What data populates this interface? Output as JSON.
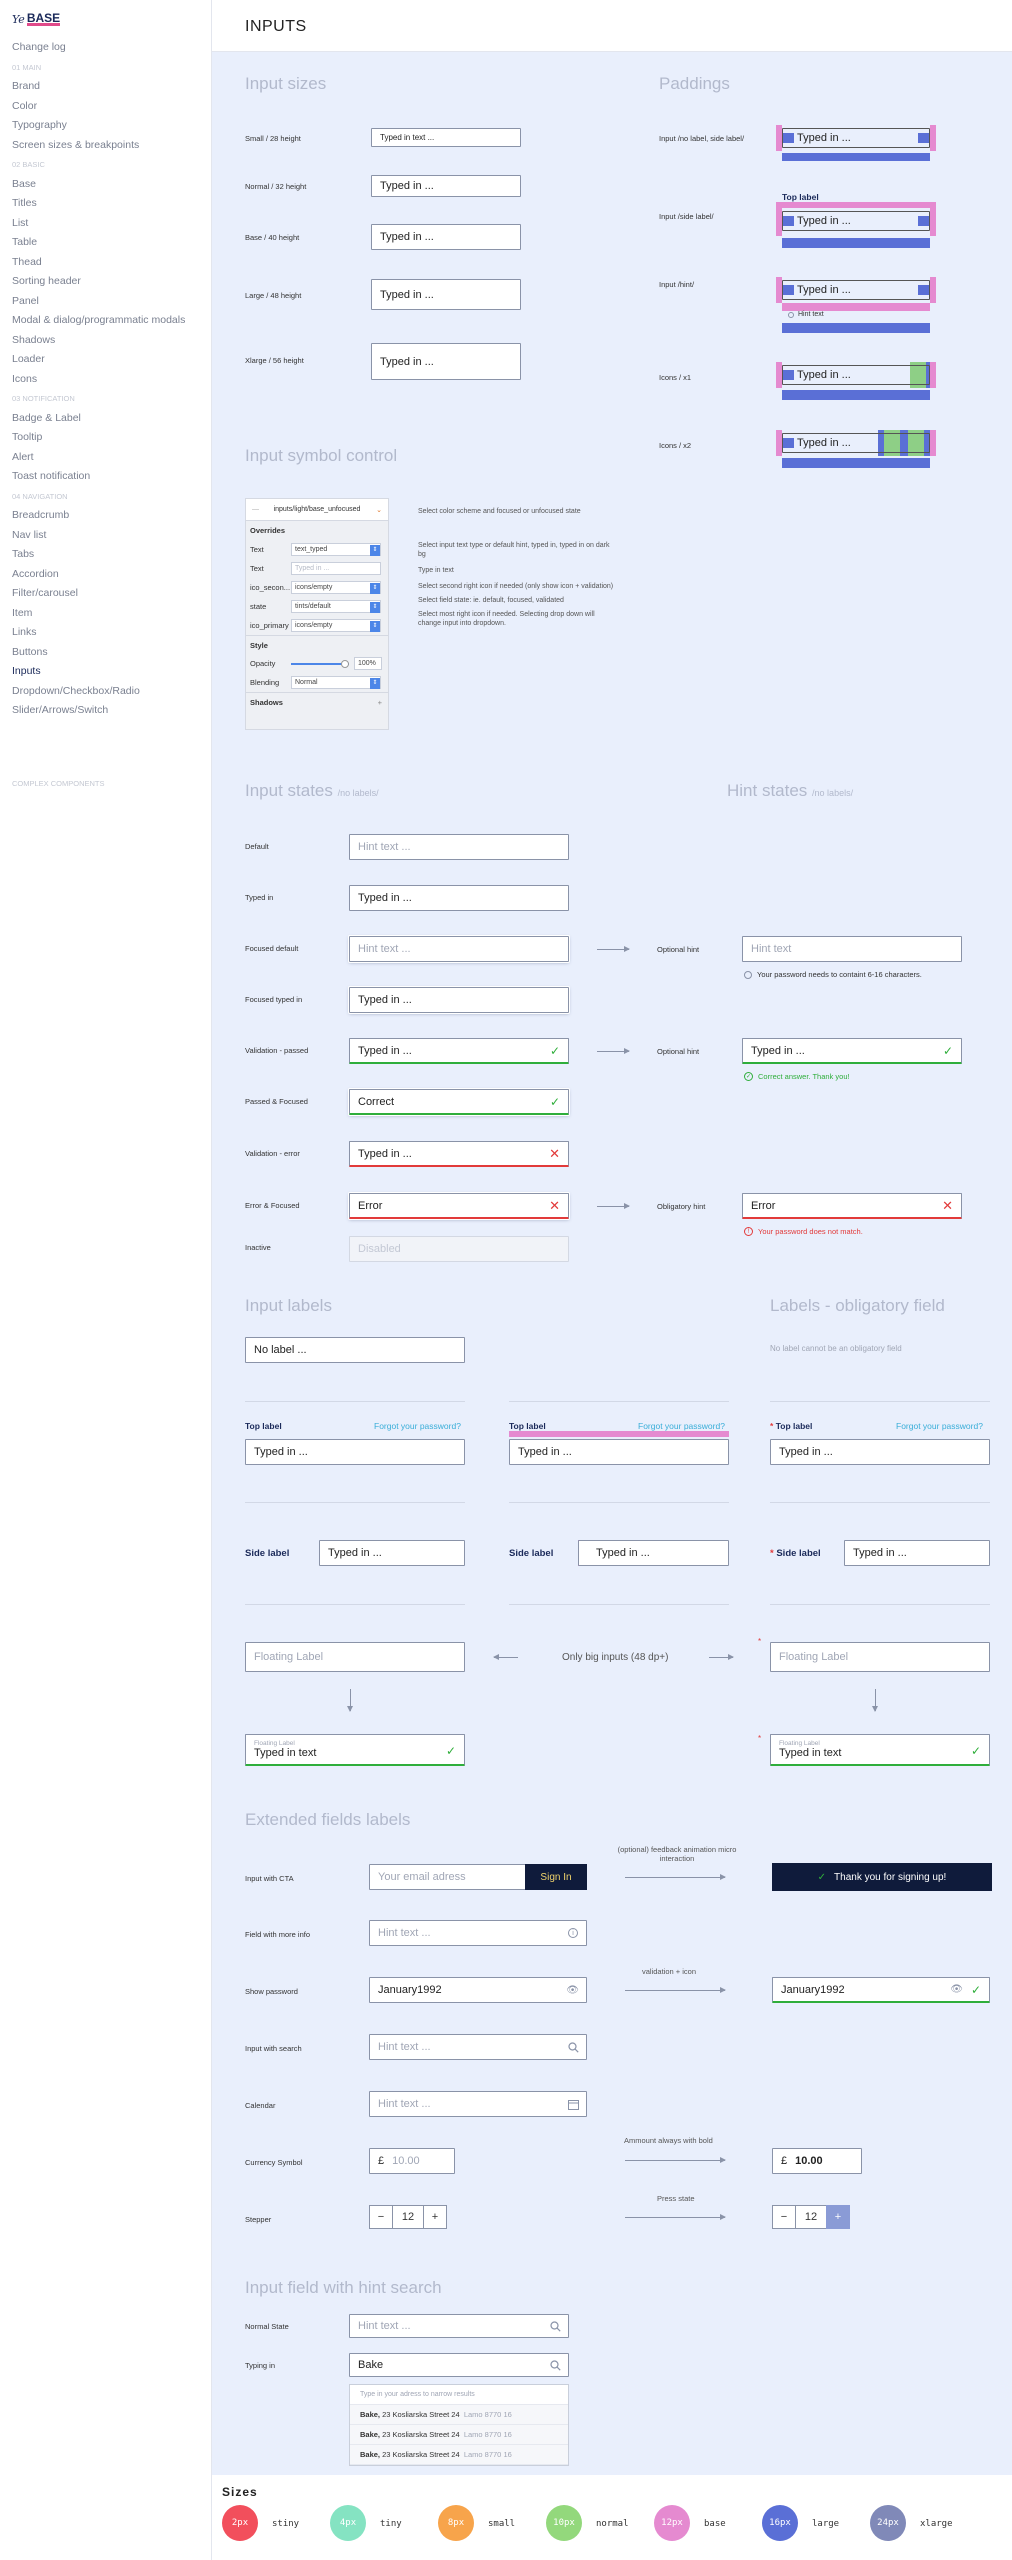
{
  "sidebar": {
    "logo_script": "Ye",
    "logo_base": "BASE",
    "items": [
      {
        "label": "Change log",
        "type": "item"
      },
      {
        "label": "01 MAIN",
        "type": "section"
      },
      {
        "label": "Brand",
        "type": "item"
      },
      {
        "label": "Color",
        "type": "item"
      },
      {
        "label": "Typography",
        "type": "item"
      },
      {
        "label": "Screen sizes & breakpoints",
        "type": "item"
      },
      {
        "label": "02 BASIC",
        "type": "section"
      },
      {
        "label": "Base",
        "type": "item"
      },
      {
        "label": "Titles",
        "type": "item"
      },
      {
        "label": "List",
        "type": "item"
      },
      {
        "label": "Table",
        "type": "item"
      },
      {
        "label": "Thead",
        "type": "item"
      },
      {
        "label": "Sorting header",
        "type": "item"
      },
      {
        "label": "Panel",
        "type": "item"
      },
      {
        "label": "Modal & dialog/programmatic modals",
        "type": "item"
      },
      {
        "label": "Shadows",
        "type": "item"
      },
      {
        "label": "Loader",
        "type": "item"
      },
      {
        "label": "Icons",
        "type": "item"
      },
      {
        "label": "03 NOTIFICATION",
        "type": "section"
      },
      {
        "label": "Badge & Label",
        "type": "item"
      },
      {
        "label": "Tooltip",
        "type": "item"
      },
      {
        "label": "Alert",
        "type": "item"
      },
      {
        "label": "Toast notification",
        "type": "item"
      },
      {
        "label": "04 NAVIGATION",
        "type": "section"
      },
      {
        "label": "Breadcrumb",
        "type": "item"
      },
      {
        "label": "Nav list",
        "type": "item"
      },
      {
        "label": "Tabs",
        "type": "item"
      },
      {
        "label": "Accordion",
        "type": "item"
      },
      {
        "label": "Filter/carousel",
        "type": "item"
      },
      {
        "label": "Item",
        "type": "item"
      },
      {
        "label": "Links",
        "type": "item"
      },
      {
        "label": "Buttons",
        "type": "item"
      },
      {
        "label": "Inputs",
        "type": "item",
        "active": true
      },
      {
        "label": "Dropdown/Checkbox/Radio",
        "type": "item"
      },
      {
        "label": "Slider/Arrows/Switch",
        "type": "item"
      }
    ],
    "footer": "COMPLEX COMPONENTS"
  },
  "header": {
    "title": "INPUTS"
  },
  "sizes_section": {
    "title": "Input sizes",
    "rows": [
      {
        "label": "Small / 28 height",
        "value": "Typed in text ..."
      },
      {
        "label": "Normal / 32 height",
        "value": "Typed in ..."
      },
      {
        "label": "Base / 40 height",
        "value": "Typed in ..."
      },
      {
        "label": "Large / 48 height",
        "value": "Typed in ..."
      },
      {
        "label": "Xlarge / 56 height",
        "value": "Typed in ..."
      }
    ]
  },
  "paddings_section": {
    "title": "Paddings",
    "rows": [
      {
        "label": "Input /no label, side label/",
        "value": "Typed in ..."
      },
      {
        "label": "Input /side label/",
        "value": "Typed in ...",
        "top_label": "Top label"
      },
      {
        "label": "Input /hint/",
        "value": "Typed in ...",
        "hint": "Hint text"
      },
      {
        "label": "Icons / x1",
        "value": "Typed in ..."
      },
      {
        "label": "Icons / x2",
        "value": "Typed in ..."
      }
    ]
  },
  "symbol_section": {
    "title": "Input symbol control",
    "selector": "inputs/light/base_unfocused",
    "overrides_title": "Overrides",
    "rows": [
      {
        "label": "Text",
        "value": "text_typed"
      },
      {
        "label": "Text",
        "value": "Typed in ..."
      },
      {
        "label": "ico_secon...",
        "value": "icons/empty"
      },
      {
        "label": "state",
        "value": "tints/default"
      },
      {
        "label": "ico_primary",
        "value": "icons/empty"
      }
    ],
    "style_title": "Style",
    "opacity_label": "Opacity",
    "opacity_value": "100%",
    "opacity_fraction": 1.0,
    "blending_label": "Blending",
    "blending_value": "Normal",
    "shadows_label": "Shadows",
    "notes": [
      "Select color scheme and focused or unfocused state",
      "Select input text type or default hint, typed in, typed in on dark bg",
      "Type in text",
      "Select second right icon if needed (only show icon + validation)",
      "Select field state: ie. default, focused, validated",
      "Select most right icon if needed. Selecting drop down will change input into dropdown."
    ]
  },
  "states_section": {
    "title": "Input states",
    "title_note": "/no labels/",
    "rows": [
      {
        "label": "Default",
        "value": "Hint text ..."
      },
      {
        "label": "Typed in",
        "value": "Typed in ..."
      },
      {
        "label": "Focused default",
        "value": "Hint text ..."
      },
      {
        "label": "Focused typed in",
        "value": "Typed in ..."
      },
      {
        "label": "Validation - passed",
        "value": "Typed in ..."
      },
      {
        "label": "Passed & Focused",
        "value": "Correct"
      },
      {
        "label": "Validation - error",
        "value": "Typed in ..."
      },
      {
        "label": "Error & Focused",
        "value": "Error"
      },
      {
        "label": "Inactive",
        "value": "Disabled"
      }
    ]
  },
  "hint_states": {
    "title": "Hint states",
    "title_note": "/no labels/",
    "rows": [
      {
        "label": "Optional hint",
        "value": "Hint text",
        "hint": "Your password needs to containt 6-16 characters."
      },
      {
        "label": "Optional hint",
        "value": "Typed in ...",
        "hint": "Correct answer. Thank you!"
      },
      {
        "label": "Obligatory hint",
        "value": "Error",
        "hint": "Your password does not match."
      }
    ]
  },
  "labels_section": {
    "title": "Input labels",
    "obligatory_title": "Labels - obligatory field",
    "no_label_value": "No label ...",
    "no_label_obligatory": "No label cannot be an obligatory field",
    "top_label": "Top label",
    "forgot": "Forgot your password?",
    "typed": "Typed in ...",
    "side_label": "Side label",
    "floating_placeholder": "Floating Label",
    "floating_small": "Floating Label",
    "floating_value": "Typed in text",
    "big_note": "Only big inputs (48 dp+)",
    "star": "*"
  },
  "extended_section": {
    "title": "Extended fields labels",
    "rows": [
      {
        "label": "Input with CTA",
        "placeholder": "Your email adress",
        "button": "Sign In"
      },
      {
        "label": "Field with more info",
        "placeholder": "Hint text ..."
      },
      {
        "label": "Show password",
        "value": "January1992"
      },
      {
        "label": "Input with search",
        "placeholder": "Hint text ..."
      },
      {
        "label": "Calendar",
        "placeholder": "Hint text ..."
      },
      {
        "label": "Currency Symbol",
        "symbol": "£",
        "placeholder": "10.00",
        "value": "10.00"
      },
      {
        "label": "Stepper",
        "minus": "−",
        "value": "12",
        "plus": "+"
      }
    ],
    "feedback_note": "(optional) feedback animation micro interaction",
    "thank_you": "Thank you for signing up!",
    "validation_note": "validation + icon",
    "amount_note": "Ammount always with bold",
    "press_note": "Press state"
  },
  "hint_search": {
    "title": "Input field with hint search",
    "normal_label": "Normal State",
    "normal_placeholder": "Hint text ...",
    "typing_label": "Typing in",
    "typing_value": "Bake",
    "dropdown_head": "Type in your adress to narrow results",
    "results": [
      {
        "bold": "Bake,",
        "rest": " 23 Kosliarska Street 24",
        "zip": "Lamo 8770 16"
      },
      {
        "bold": "Bake,",
        "rest": " 23 Kosliarska Street 24",
        "zip": "Lamo 8770 16"
      },
      {
        "bold": "Bake,",
        "rest": " 23 Kosliarska Street 24",
        "zip": "Lamo 8770 16"
      }
    ]
  },
  "sizes_legend": {
    "title": "Sizes",
    "items": [
      {
        "px": "2px",
        "name": "stiny",
        "color": "#f24f5c"
      },
      {
        "px": "4px",
        "name": "tiny",
        "color": "#85e3c2"
      },
      {
        "px": "8px",
        "name": "small",
        "color": "#f7a44b"
      },
      {
        "px": "10px",
        "name": "normal",
        "color": "#93d87c"
      },
      {
        "px": "12px",
        "name": "base",
        "color": "#e58ad0"
      },
      {
        "px": "16px",
        "name": "large",
        "color": "#5a6fd6"
      },
      {
        "px": "24px",
        "name": "xlarge",
        "color": "#8089b8"
      }
    ]
  }
}
